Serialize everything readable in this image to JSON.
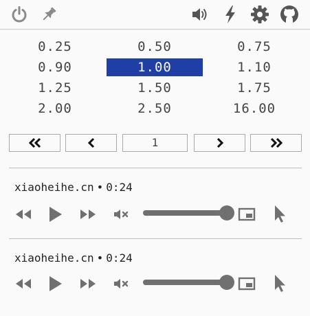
{
  "toolbar": {
    "left_icons": [
      "power-icon",
      "pin-icon"
    ],
    "right_icons": [
      "volume-icon",
      "lightning-icon",
      "gear-icon",
      "github-icon"
    ],
    "icon_color": "#555555",
    "left_icon_color": "#8a8a8a"
  },
  "speed_grid": {
    "rows": [
      [
        "0.25",
        "0.50",
        "0.75"
      ],
      [
        "0.90",
        "1.00",
        "1.10"
      ],
      [
        "1.25",
        "1.50",
        "1.75"
      ],
      [
        "2.00",
        "2.50",
        "16.00"
      ]
    ],
    "selected": "1.00",
    "selected_color": "#1f3fa6"
  },
  "pager": {
    "first_icon": "double-chevron-left-icon",
    "prev_icon": "chevron-left-icon",
    "page": "1",
    "next_icon": "chevron-right-icon",
    "last_icon": "double-chevron-right-icon"
  },
  "players": [
    {
      "site": "xiaoheihe.cn",
      "separator": "•",
      "time": "0:24",
      "volume": 1.0,
      "icons": [
        "rewind-icon",
        "play-icon",
        "fast-forward-icon",
        "mute-icon",
        "picture-in-picture-icon",
        "cursor-icon"
      ]
    },
    {
      "site": "xiaoheihe.cn",
      "separator": "•",
      "time": "0:24",
      "volume": 1.0,
      "icons": [
        "rewind-icon",
        "play-icon",
        "fast-forward-icon",
        "mute-icon",
        "picture-in-picture-icon",
        "cursor-icon"
      ]
    }
  ],
  "accent": "#707070"
}
